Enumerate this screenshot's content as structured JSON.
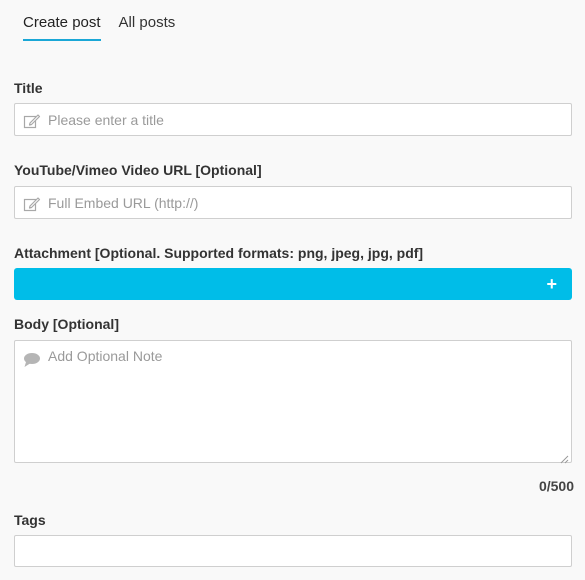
{
  "tabs": {
    "create": "Create post",
    "all": "All posts"
  },
  "title": {
    "label": "Title",
    "placeholder": "Please enter a title",
    "icon": "edit-icon"
  },
  "video": {
    "label": "YouTube/Vimeo Video URL [Optional]",
    "placeholder": "Full Embed URL (http://)",
    "icon": "edit-icon"
  },
  "attachment": {
    "label": "Attachment [Optional. Supported formats: png, jpeg, jpg, pdf]",
    "button_icon": "+",
    "color": "#00bde8"
  },
  "body": {
    "label": "Body [Optional]",
    "placeholder": "Add Optional Note",
    "icon": "comment-icon",
    "counter": "0/500"
  },
  "tags": {
    "label": "Tags"
  },
  "colors": {
    "accent": "#1aa7d6",
    "background": "#f9f9f9"
  }
}
